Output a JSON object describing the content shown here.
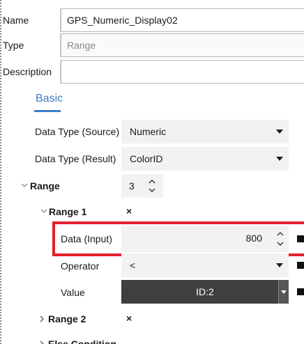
{
  "header": {
    "name_label": "Name",
    "name_value": "GPS_Numeric_Display02",
    "type_label": "Type",
    "type_value": "Range",
    "description_label": "Description",
    "description_value": ""
  },
  "tabs": {
    "basic": "Basic"
  },
  "properties": {
    "data_type_source_label": "Data Type (Source)",
    "data_type_source_value": "Numeric",
    "data_type_result_label": "Data Type (Result)",
    "data_type_result_value": "ColorID",
    "range_label": "Range",
    "range_value": "3",
    "range1_label": "Range 1",
    "range1_delete": "×",
    "data_input_label": "Data (Input)",
    "data_input_value": "800",
    "operator_label": "Operator",
    "operator_value": "<",
    "value_label": "Value",
    "value_value": "ID:2",
    "range2_label": "Range 2",
    "range2_delete": "×",
    "else_label": "Else Condition"
  },
  "icons": {
    "expanded": "chevron-expanded-icon",
    "collapsed": "chevron-right-icon",
    "dropdown": "dropdown-arrow-icon",
    "spinner": "spinner-icon",
    "delete": "delete-icon"
  },
  "colors": {
    "accent": "#3a7fc4",
    "highlight": "#e5202e",
    "dark_field": "#3f3f3f"
  }
}
